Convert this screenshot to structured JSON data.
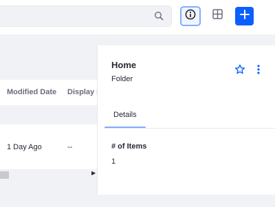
{
  "toolbar": {
    "search_placeholder": "",
    "icons": [
      "search-icon",
      "info-circle-icon",
      "cards-view-icon",
      "plus-icon"
    ],
    "accent_color": "#0b5fff",
    "active_outline_color": "#80acff"
  },
  "table": {
    "columns": [
      "Modified Date",
      "Display D"
    ],
    "rows": [
      {
        "modified_date": "1 Day Ago",
        "display_date": "--"
      }
    ]
  },
  "info_panel": {
    "title": "Home",
    "subtitle": "Folder",
    "tabs": [
      {
        "label": "Details",
        "active": true
      }
    ],
    "fields": [
      {
        "label": "# of Items",
        "value": "1"
      }
    ],
    "icons": [
      "star-icon",
      "kebab-menu-icon"
    ]
  }
}
